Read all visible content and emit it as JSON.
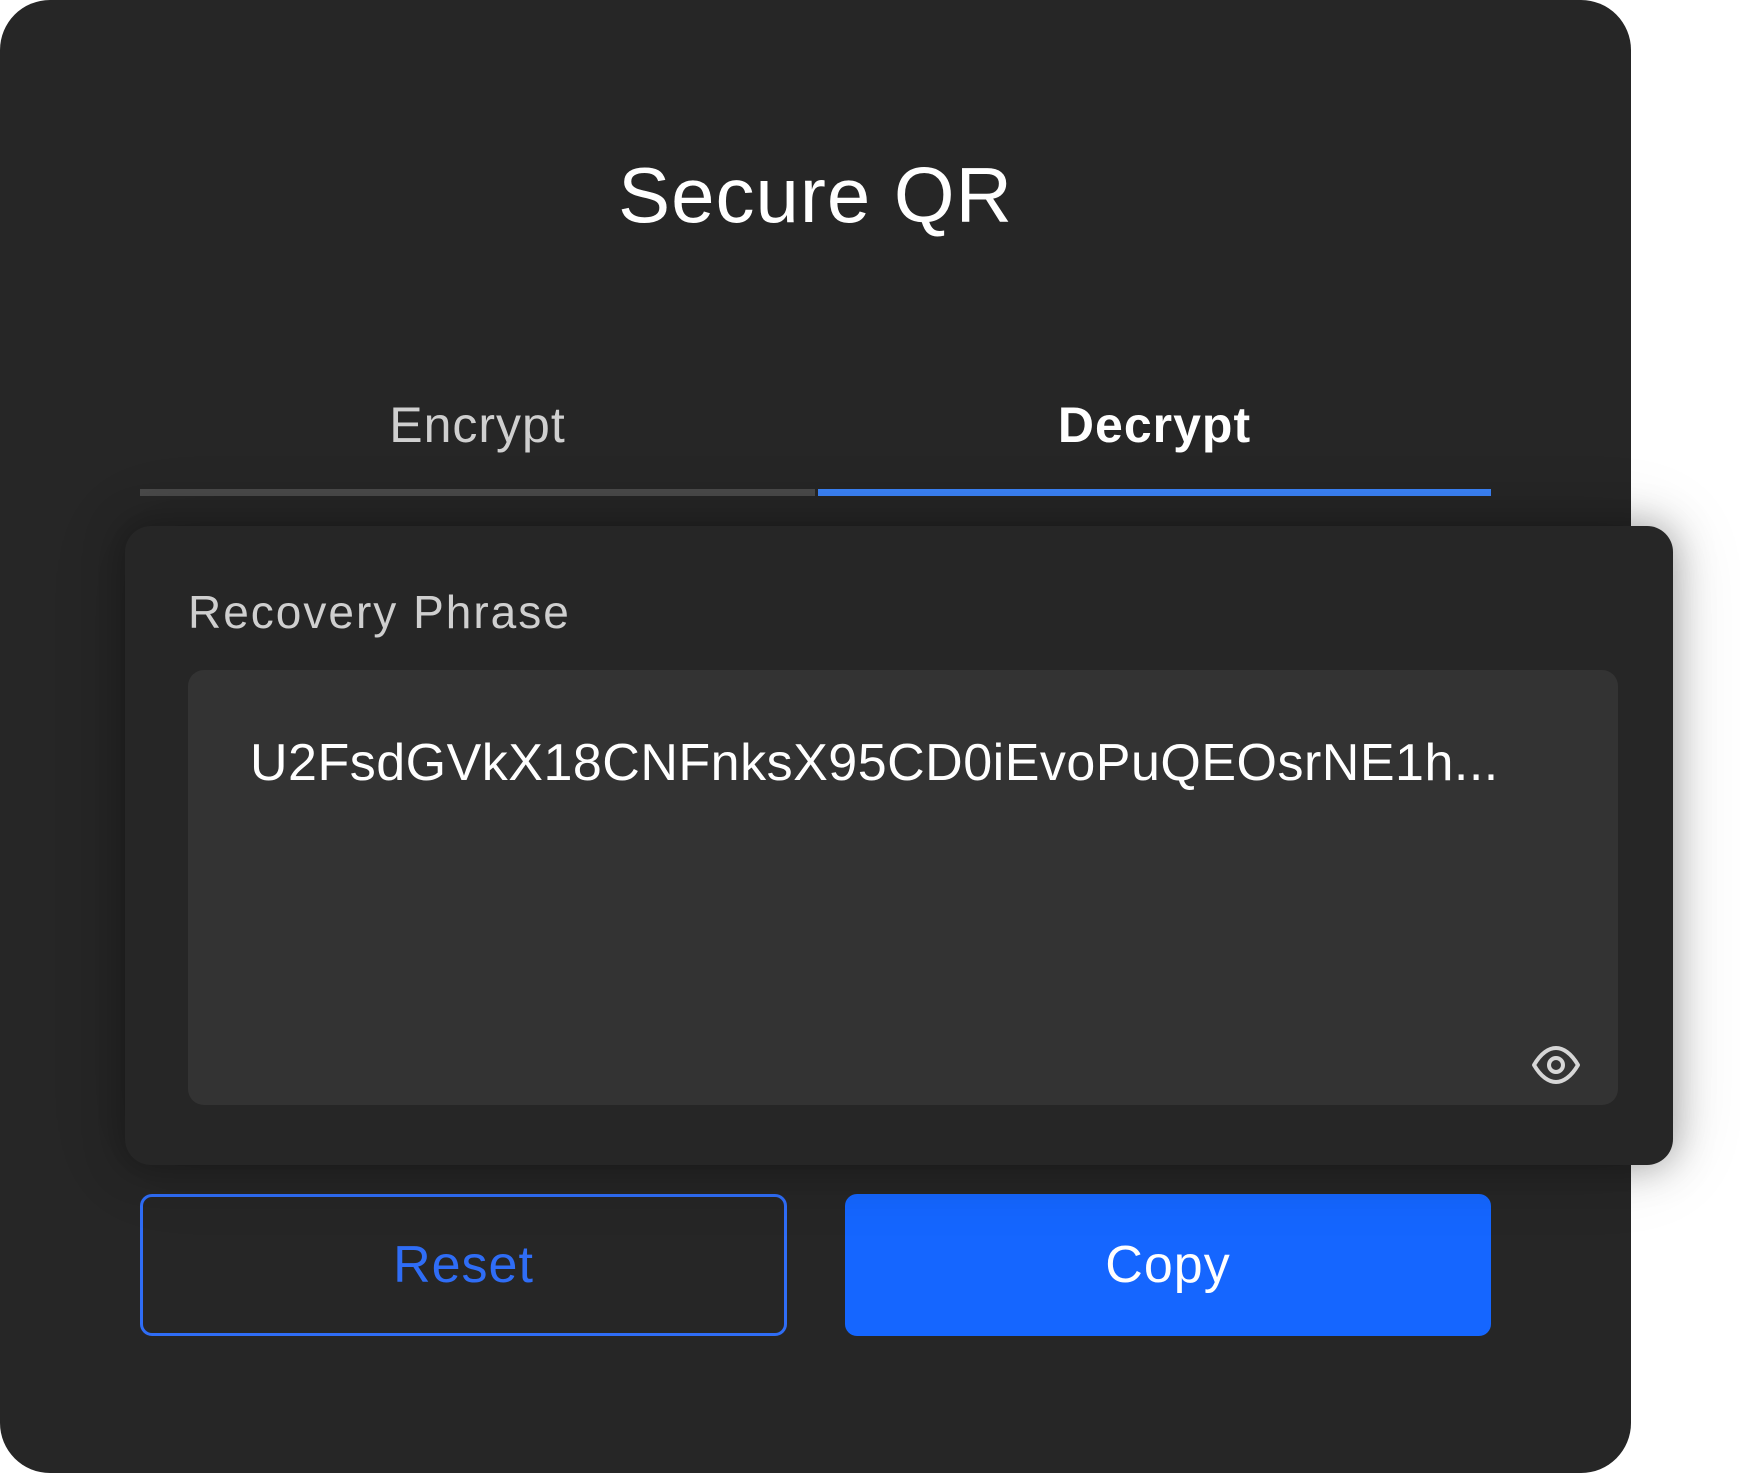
{
  "app": {
    "title": "Secure QR"
  },
  "tabs": [
    {
      "label": "Encrypt",
      "active": false
    },
    {
      "label": "Decrypt",
      "active": true
    }
  ],
  "recovery": {
    "label": "Recovery Phrase",
    "value": "U2FsdGVkX18CNFnksX95CD0iEvoPuQEOsrNE1h...",
    "reveal_icon": "eye-icon"
  },
  "actions": {
    "reset_label": "Reset",
    "copy_label": "Copy"
  },
  "colors": {
    "background": "#262626",
    "accent": "#1566ff",
    "field": "#333333"
  }
}
